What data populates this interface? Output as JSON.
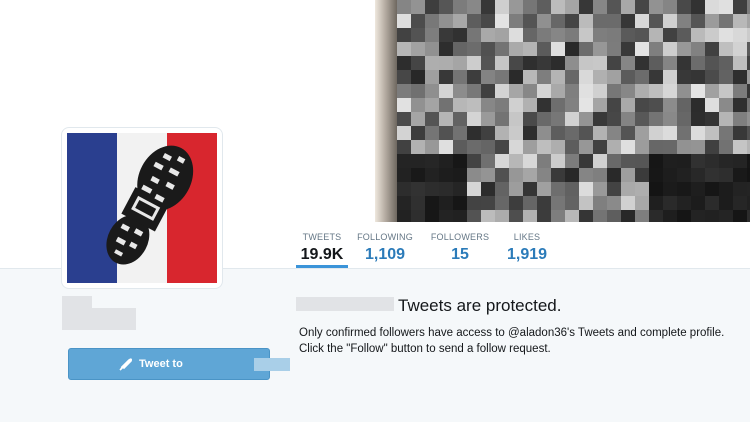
{
  "nav": {
    "stats": [
      {
        "label": "TWEETS",
        "value": "19.9K",
        "active": true
      },
      {
        "label": "FOLLOWING",
        "value": "1,109",
        "active": false
      },
      {
        "label": "FOLLOWERS",
        "value": "15",
        "active": false
      },
      {
        "label": "LIKES",
        "value": "1,919",
        "active": false
      }
    ]
  },
  "profile": {
    "tweet_button_label": "Tweet to"
  },
  "protected": {
    "title": "Tweets are protected.",
    "message": "Only confirmed followers have access to @aladon36's Tweets and complete profile. Click the \"Follow\" button to send a follow request."
  },
  "colors": {
    "accent": "#2b7bb9",
    "tab_underline": "#3b94d9",
    "tweet_button": "#5fa6d6",
    "background": "#f5f8fa"
  },
  "icons": {
    "tweet_button": "quill-icon"
  }
}
